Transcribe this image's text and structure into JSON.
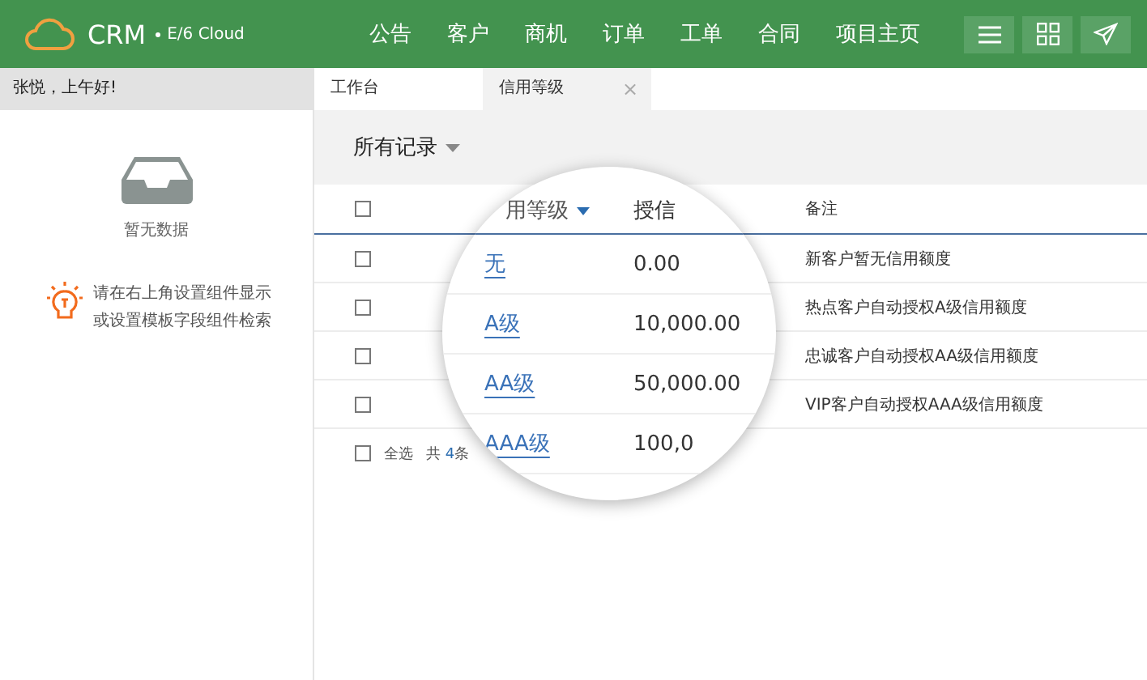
{
  "header": {
    "brand": "CRM",
    "product": "E/6 Cloud",
    "nav": [
      "公告",
      "客户",
      "商机",
      "订单",
      "工单",
      "合同",
      "项目主页"
    ]
  },
  "greeting": "张悦，上午好!",
  "tabs": [
    {
      "label": "工作台",
      "selected": false,
      "closable": false
    },
    {
      "label": "信用等级",
      "selected": true,
      "closable": true
    }
  ],
  "close_glyph": "×",
  "sidebar": {
    "empty_text": "暂无数据",
    "tip": "请在右上角设置组件显示或设置模板字段组件检索"
  },
  "view": {
    "label": "所有记录"
  },
  "table": {
    "remark_header": "备注",
    "header_checked": false,
    "rows": [
      {
        "remark": "新客户暂无信用额度",
        "checked": false
      },
      {
        "remark": "热点客户自动授权A级信用额度",
        "checked": false
      },
      {
        "remark": "忠诚客户自动授权AA级信用额度",
        "checked": false
      },
      {
        "remark": "VIP客户自动授权AAA级信用额度",
        "checked": false
      }
    ],
    "footer": {
      "select_all_checked": false,
      "select_all": "全选",
      "total_prefix": "共",
      "total_count": "4",
      "total_suffix": "条"
    }
  },
  "magnifier": {
    "columns": [
      "用等级",
      "授信"
    ],
    "rows": [
      {
        "level": "无",
        "amount": "0.00"
      },
      {
        "level": "A级",
        "amount": "10,000.00"
      },
      {
        "level": "AA级",
        "amount": "50,000.00"
      },
      {
        "level": "AAA级",
        "amount": "100,0"
      }
    ]
  }
}
